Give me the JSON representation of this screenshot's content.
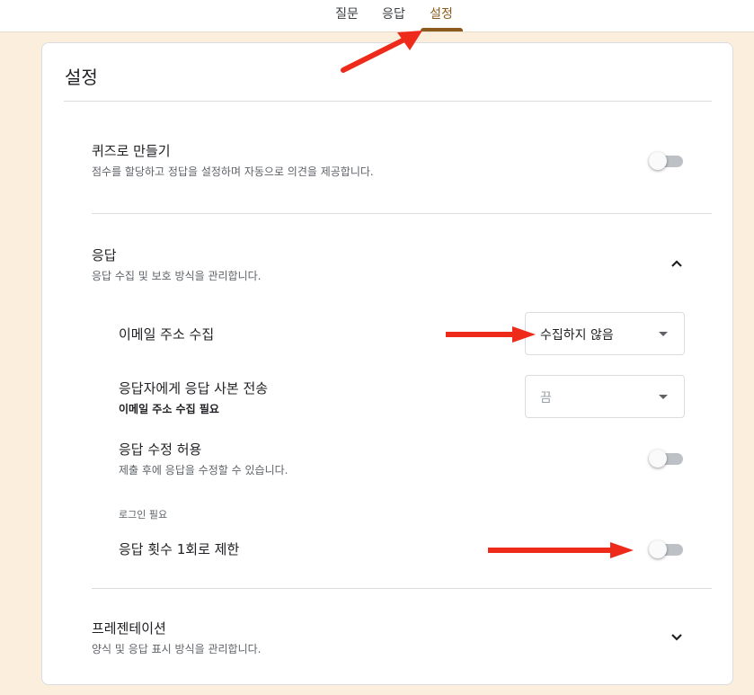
{
  "tabs": [
    {
      "label": "질문"
    },
    {
      "label": "응답"
    },
    {
      "label": "설정"
    }
  ],
  "settings": {
    "title": "설정",
    "quiz": {
      "title": "퀴즈로 만들기",
      "description": "점수를 할당하고 정답을 설정하며 자동으로 의견을 제공합니다.",
      "enabled": false
    },
    "responses": {
      "title": "응답",
      "description": "응답 수집 및 보호 방식을 관리합니다.",
      "expanded": true,
      "collect_email": {
        "label": "이메일 주소 수집",
        "value": "수집하지 않음"
      },
      "send_copy": {
        "label": "응답자에게 응답 사본 전송",
        "note": "이메일 주소 수집 필요",
        "value": "끔"
      },
      "allow_edit": {
        "label": "응답 수정 허용",
        "description": "제출 후에 응답을 수정할 수 있습니다.",
        "enabled": false
      },
      "login_required_label": "로그인 필요",
      "limit_one": {
        "label": "응답 횟수 1회로 제한",
        "enabled": false
      }
    },
    "presentation": {
      "title": "프레젠테이션",
      "description": "양식 및 응답 표시 방식을 관리합니다.",
      "expanded": false
    }
  },
  "colors": {
    "page_background": "#fbeedd",
    "accent": "#8b5a1c",
    "annotation_arrow": "#ee2a1b"
  }
}
